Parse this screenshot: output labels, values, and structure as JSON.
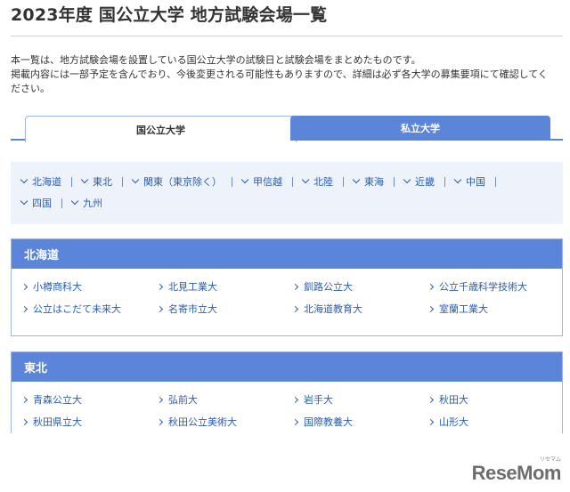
{
  "page_title": "2023年度 国公立大学 地方試験会場一覧",
  "intro": {
    "line1": "本一覧は、地方試験会場を設置している国公立大学の試験日と試験会場をまとめたものです。",
    "line2": "掲載内容には一部予定を含んでおり、今後変更される可能性もありますので、詳細は必ず各大学の募集要項にて確認してく",
    "line3": "ださい。"
  },
  "tabs": {
    "national": "国公立大学",
    "private": "私立大学"
  },
  "regions": [
    "北海道",
    "東北",
    "関東（東京除く）",
    "甲信越",
    "北陸",
    "東海",
    "近畿",
    "中国",
    "四国",
    "九州"
  ],
  "sections": {
    "hokkaido": {
      "title": "北海道",
      "universities": [
        "小樽商科大",
        "北見工業大",
        "釧路公立大",
        "公立千歳科学技術大",
        "公立はこだて未来大",
        "名寄市立大",
        "北海道教育大",
        "室蘭工業大"
      ]
    },
    "tohoku": {
      "title": "東北",
      "universities": [
        "青森公立大",
        "弘前大",
        "岩手大",
        "秋田大",
        "秋田県立大",
        "秋田公立美術大",
        "国際教養大",
        "山形大"
      ]
    }
  },
  "logo": {
    "text": "ReseMom",
    "sup": "リセマム"
  }
}
